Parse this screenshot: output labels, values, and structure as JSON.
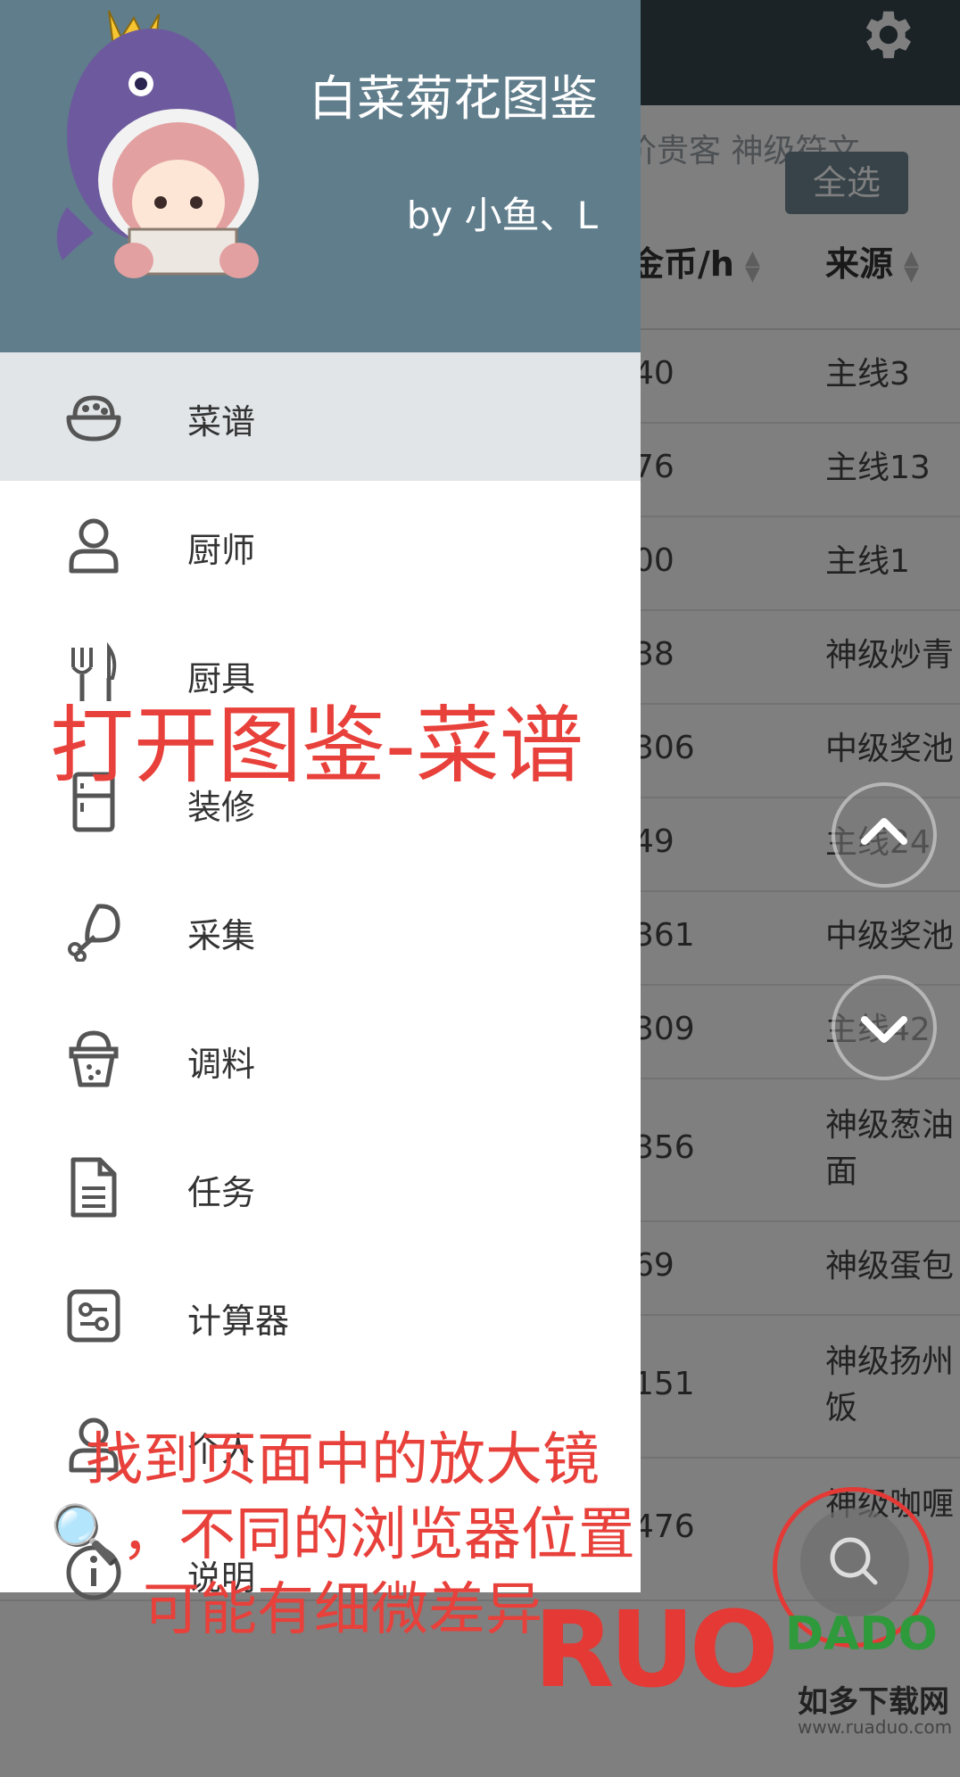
{
  "colors": {
    "topbar": "#37474f",
    "drawer_header": "#607d8b",
    "active_item_bg": "#e1e5e8",
    "caption_red": "#e8403a",
    "select_all_bg": "#6f8791"
  },
  "background": {
    "filters_text": "价贵客 神级符文",
    "select_all_label": "全选",
    "columns": {
      "gold": "金币/h",
      "source": "来源"
    },
    "rows": [
      {
        "gold": "40",
        "source": "主线3"
      },
      {
        "gold": "76",
        "source": "主线13"
      },
      {
        "gold": "00",
        "source": "主线1"
      },
      {
        "gold": "38",
        "source": "神级炒青"
      },
      {
        "gold": "306",
        "source": "中级奖池"
      },
      {
        "gold": "49",
        "source": "主线24"
      },
      {
        "gold": "361",
        "source": "中级奖池"
      },
      {
        "gold": "309",
        "source": "主线42"
      },
      {
        "gold": "356",
        "source": "神级葱油面"
      },
      {
        "gold": "69",
        "source": "神级蛋包"
      },
      {
        "gold": "151",
        "source": "神级扬州饭"
      },
      {
        "gold": "476",
        "source": "神级咖喱"
      }
    ]
  },
  "drawer": {
    "title": "白菜菊花图鉴",
    "author": "by 小鱼、L",
    "menu": [
      {
        "label": "菜谱",
        "icon": "bowl-icon"
      },
      {
        "label": "厨师",
        "icon": "person-icon"
      },
      {
        "label": "厨具",
        "icon": "utensils-icon"
      },
      {
        "label": "装修",
        "icon": "fridge-icon"
      },
      {
        "label": "采集",
        "icon": "drumstick-icon"
      },
      {
        "label": "调料",
        "icon": "seasoning-cup-icon"
      },
      {
        "label": "任务",
        "icon": "document-icon"
      },
      {
        "label": "计算器",
        "icon": "calculator-icon"
      },
      {
        "label": "个人",
        "icon": "person-icon"
      },
      {
        "label": "说明",
        "icon": "info-icon"
      }
    ]
  },
  "overlay": {
    "caption_1": "打开图鉴-菜谱",
    "caption_2": "找到页面中的放大镜🔍，不同的浏览器位置可能有细微差异",
    "watermark_letters": "RUO",
    "watermark_badge": "DADO",
    "watermark_cn": "如多下载网",
    "watermark_url": "www.ruaduo.com"
  }
}
